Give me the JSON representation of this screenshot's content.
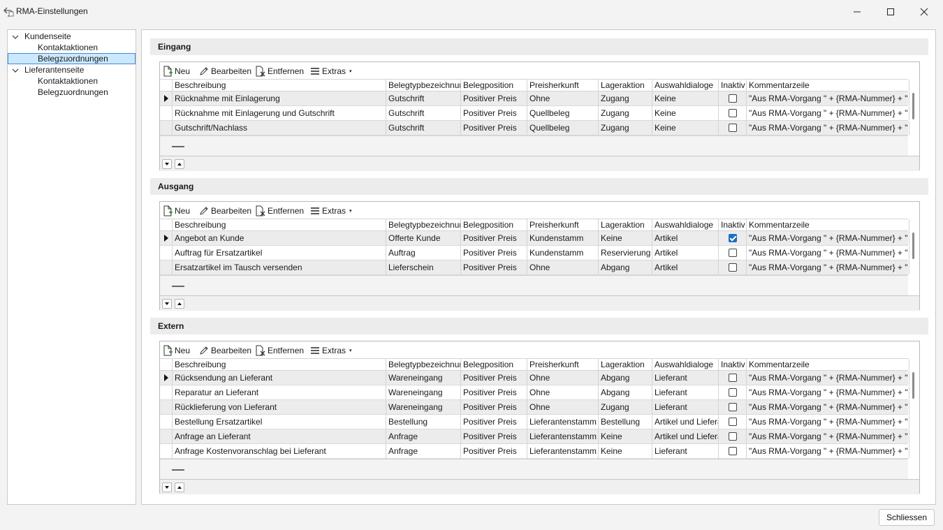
{
  "window": {
    "title": "RMA-Einstellungen",
    "icon": "rma-back-arrow-icon"
  },
  "tree": {
    "groups": [
      {
        "label": "Kundenseite",
        "expanded": true,
        "children": [
          "Kontaktaktionen",
          "Belegzuordnungen"
        ]
      },
      {
        "label": "Lieferantenseite",
        "expanded": true,
        "children": [
          "Kontaktaktionen",
          "Belegzuordnungen"
        ]
      }
    ],
    "selected": "Kundenseite/Belegzuordnungen"
  },
  "toolbar": {
    "new_label": "Neu",
    "edit_label": "Bearbeiten",
    "remove_label": "Entfernen",
    "extras_label": "Extras"
  },
  "columns": [
    "Beschreibung",
    "Belegtypbezeichnung",
    "Belegposition",
    "Preisherkunft",
    "Lageraktion",
    "Auswahldialoge",
    "Inaktiv",
    "Kommentarzeile"
  ],
  "sections": [
    {
      "title": "Eingang",
      "rows": [
        [
          "Rücknahme mit Einlagerung",
          "Gutschrift",
          "Positiver Preis",
          "Ohne",
          "Zugang",
          "Keine",
          false,
          "\"Aus RMA-Vorgang \" + {RMA-Nummer} + \" Rück"
        ],
        [
          "Rücknahme mit Einlagerung und Gutschrift",
          "Gutschrift",
          "Positiver Preis",
          "Quellbeleg",
          "Zugang",
          "Keine",
          false,
          "\"Aus RMA-Vorgang \" + {RMA-Nummer} + \" Rück"
        ],
        [
          "Gutschrift/Nachlass",
          "Gutschrift",
          "Positiver Preis",
          "Quellbeleg",
          "Zugang",
          "Keine",
          false,
          "\"Aus RMA-Vorgang \" + {RMA-Nummer} + \" Guts"
        ]
      ]
    },
    {
      "title": "Ausgang",
      "rows": [
        [
          "Angebot an Kunde",
          "Offerte Kunde",
          "Positiver Preis",
          "Kundenstamm",
          "Keine",
          "Artikel",
          true,
          "\"Aus RMA-Vorgang \" + {RMA-Nummer} + \" Ange"
        ],
        [
          "Auftrag für Ersatzartikel",
          "Auftrag",
          "Positiver Preis",
          "Kundenstamm",
          "Reservierung",
          "Artikel",
          false,
          "\"Aus RMA-Vorgang \" + {RMA-Nummer} + \" Auftr"
        ],
        [
          "Ersatzartikel im Tausch versenden",
          "Lieferschein",
          "Positiver Preis",
          "Ohne",
          "Abgang",
          "Artikel",
          false,
          "\"Aus RMA-Vorgang \" + {RMA-Nummer} + \" Ersat"
        ]
      ]
    },
    {
      "title": "Extern",
      "rows": [
        [
          "Rücksendung an Lieferant",
          "Wareneingang",
          "Positiver Preis",
          "Ohne",
          "Abgang",
          "Lieferant",
          false,
          "\"Aus RMA-Vorgang \" + {RMA-Nummer} + \" Rück"
        ],
        [
          "Reparatur an Lieferant",
          "Wareneingang",
          "Positiver Preis",
          "Ohne",
          "Abgang",
          "Lieferant",
          false,
          "\"Aus RMA-Vorgang \" + {RMA-Nummer} + \" Repa"
        ],
        [
          "Rücklieferung von Lieferant",
          "Wareneingang",
          "Positiver Preis",
          "Ohne",
          "Zugang",
          "Lieferant",
          false,
          "\"Aus RMA-Vorgang \" + {RMA-Nummer} + \" Rück"
        ],
        [
          "Bestellung Ersatzartikel",
          "Bestellung",
          "Positiver Preis",
          "Lieferantenstamm",
          "Bestellung",
          "Artikel und Lieferant",
          false,
          "\"Aus RMA-Vorgang \" + {RMA-Nummer} + \" Beste"
        ],
        [
          "Anfrage an Lieferant",
          "Anfrage",
          "Positiver Preis",
          "Lieferantenstamm",
          "Keine",
          "Artikel und Lieferant",
          false,
          "\"Aus RMA-Vorgang \" + {RMA-Nummer} + \" Anfra"
        ],
        [
          "Anfrage Kostenvoranschlag bei Lieferant",
          "Anfrage",
          "Positiver Preis",
          "Lieferantenstamm",
          "Keine",
          "Lieferant",
          false,
          "\"Aus RMA-Vorgang \" + {RMA-Nummer} + \" Anfra"
        ]
      ]
    }
  ],
  "footer": {
    "close_label": "Schliessen"
  },
  "colors": {
    "selection": "#cce8ff",
    "selection_border": "#3c8cd6",
    "checkbox_checked": "#1d6fc6",
    "alt_row": "#ececec"
  }
}
